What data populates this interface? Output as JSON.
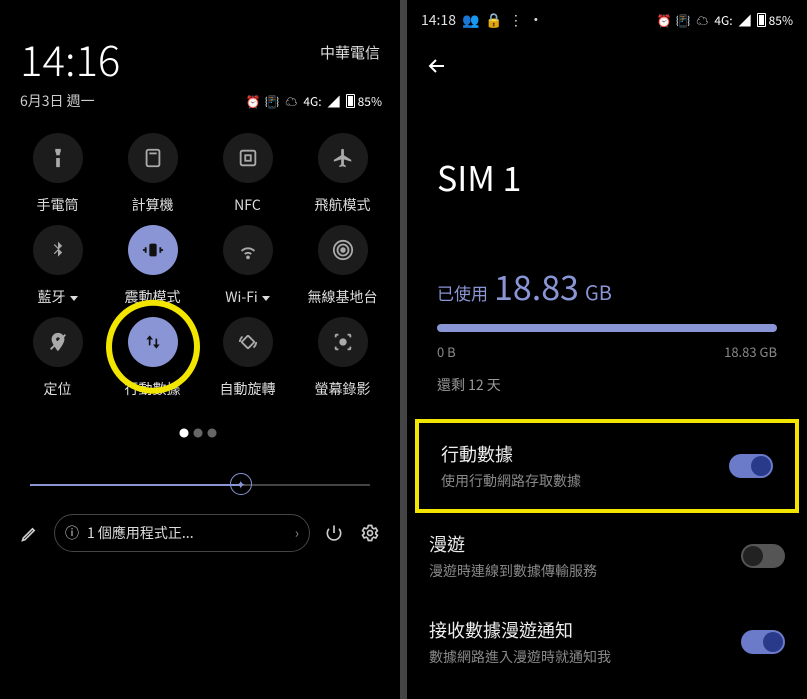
{
  "left": {
    "clock": "14:16",
    "date": "6月3日 週一",
    "carrier": "中華電信",
    "battery": "85%",
    "network_label": "4G:",
    "tiles": [
      {
        "key": "flashlight",
        "label": "手電筒",
        "active": false
      },
      {
        "key": "calculator",
        "label": "計算機",
        "active": false
      },
      {
        "key": "nfc",
        "label": "NFC",
        "active": false
      },
      {
        "key": "airplane",
        "label": "飛航模式",
        "active": false
      },
      {
        "key": "bluetooth",
        "label": "藍牙",
        "active": false,
        "caret": true
      },
      {
        "key": "vibrate",
        "label": "震動模式",
        "active": true
      },
      {
        "key": "wifi",
        "label": "Wi-Fi",
        "active": false,
        "caret": true
      },
      {
        "key": "hotspot",
        "label": "無線基地台",
        "active": false
      },
      {
        "key": "location",
        "label": "定位",
        "active": false
      },
      {
        "key": "mobiledata",
        "label": "行動數據",
        "active": true,
        "highlight": true
      },
      {
        "key": "rotate",
        "label": "自動旋轉",
        "active": false
      },
      {
        "key": "screenrec",
        "label": "螢幕錄影",
        "active": false
      }
    ],
    "notif_pill": "1 個應用程式正..."
  },
  "right": {
    "time": "14:18",
    "battery": "85%",
    "network_label": "4G:",
    "title": "SIM 1",
    "usage_prefix": "已使用",
    "usage_value": "18.83",
    "usage_unit": "GB",
    "bar_min": "0 B",
    "bar_max": "18.83 GB",
    "remaining": "還剩 12 天",
    "rows": [
      {
        "title": "行動數據",
        "subtitle": "使用行動網路存取數據",
        "on": true,
        "highlight": true
      },
      {
        "title": "漫遊",
        "subtitle": "漫遊時連線到數據傳輸服務",
        "on": false
      },
      {
        "title": "接收數據漫遊通知",
        "subtitle": "數據網路進入漫遊時就通知我",
        "on": true
      }
    ]
  }
}
